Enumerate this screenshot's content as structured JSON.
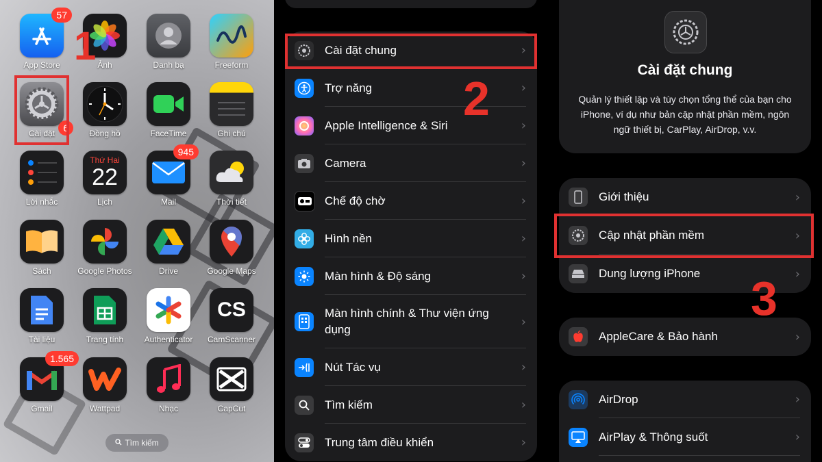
{
  "home": {
    "apps": [
      {
        "name": "App Store",
        "badge": "57"
      },
      {
        "name": "Ảnh",
        "badge": ""
      },
      {
        "name": "Danh bạ",
        "badge": ""
      },
      {
        "name": "Freeform",
        "badge": ""
      },
      {
        "name": "Cài đặt",
        "badge": "6"
      },
      {
        "name": "Đồng hồ",
        "badge": ""
      },
      {
        "name": "FaceTime",
        "badge": ""
      },
      {
        "name": "Ghi chú",
        "badge": ""
      },
      {
        "name": "Lời nhắc",
        "badge": ""
      },
      {
        "name": "Lịch",
        "badge": ""
      },
      {
        "name": "Mail",
        "badge": "945"
      },
      {
        "name": "Thời tiết",
        "badge": ""
      },
      {
        "name": "Sách",
        "badge": ""
      },
      {
        "name": "Google Photos",
        "badge": ""
      },
      {
        "name": "Drive",
        "badge": ""
      },
      {
        "name": "Google Maps",
        "badge": ""
      },
      {
        "name": "Tài liệu",
        "badge": ""
      },
      {
        "name": "Trang tính",
        "badge": ""
      },
      {
        "name": "Authenticator",
        "badge": ""
      },
      {
        "name": "CamScanner",
        "badge": ""
      },
      {
        "name": "Gmail",
        "badge": "1.565"
      },
      {
        "name": "Wattpad",
        "badge": ""
      },
      {
        "name": "Nhạc",
        "badge": ""
      },
      {
        "name": "CapCut",
        "badge": ""
      }
    ],
    "calendar_day": "Thứ Hai",
    "calendar_date": "22",
    "camscanner_text": "CS",
    "search_label": "Tìm kiếm",
    "step": "1"
  },
  "settings": {
    "items": [
      {
        "label": "Cài đặt chung",
        "icon": "gear-icon",
        "color": "#8e8e93"
      },
      {
        "label": "Trợ năng",
        "icon": "accessibility-icon",
        "color": "#0a84ff"
      },
      {
        "label": "Apple Intelligence & Siri",
        "icon": "siri-icon",
        "color": "#ff6fb5"
      },
      {
        "label": "Camera",
        "icon": "camera-icon",
        "color": "#8e8e93"
      },
      {
        "label": "Chế độ chờ",
        "icon": "standby-icon",
        "color": "#2c2c2e"
      },
      {
        "label": "Hình nền",
        "icon": "flower-icon",
        "color": "#32ade6"
      },
      {
        "label": "Màn hình & Độ sáng",
        "icon": "brightness-icon",
        "color": "#0a84ff"
      },
      {
        "label": "Màn hình chính & Thư viện ứng dụng",
        "icon": "home-screen-icon",
        "color": "#0a84ff"
      },
      {
        "label": "Nút Tác vụ",
        "icon": "action-button-icon",
        "color": "#0a84ff"
      },
      {
        "label": "Tìm kiếm",
        "icon": "search-icon",
        "color": "#8e8e93"
      },
      {
        "label": "Trung tâm điều khiển",
        "icon": "control-center-icon",
        "color": "#8e8e93"
      }
    ],
    "step": "2"
  },
  "general": {
    "title": "Cài đặt chung",
    "description": "Quản lý thiết lập và tùy chọn tổng thể của bạn cho iPhone, ví dụ như bản cập nhật phần mềm, ngôn ngữ thiết bị, CarPlay, AirDrop, v.v.",
    "group1": [
      {
        "label": "Giới thiệu",
        "icon": "phone-icon",
        "color": "#8e8e93"
      },
      {
        "label": "Cập nhật phần mềm",
        "icon": "gear-icon",
        "color": "#8e8e93"
      },
      {
        "label": "Dung lượng iPhone",
        "icon": "storage-icon",
        "color": "#8e8e93"
      }
    ],
    "group2": [
      {
        "label": "AppleCare & Bảo hành",
        "icon": "apple-icon",
        "color": "#ff3b30"
      }
    ],
    "group3": [
      {
        "label": "AirDrop",
        "icon": "airdrop-icon",
        "color": "#0a84ff"
      },
      {
        "label": "AirPlay & Thông suốt",
        "icon": "airplay-icon",
        "color": "#0a84ff"
      }
    ],
    "step": "3"
  },
  "accent_color": "#e03131"
}
